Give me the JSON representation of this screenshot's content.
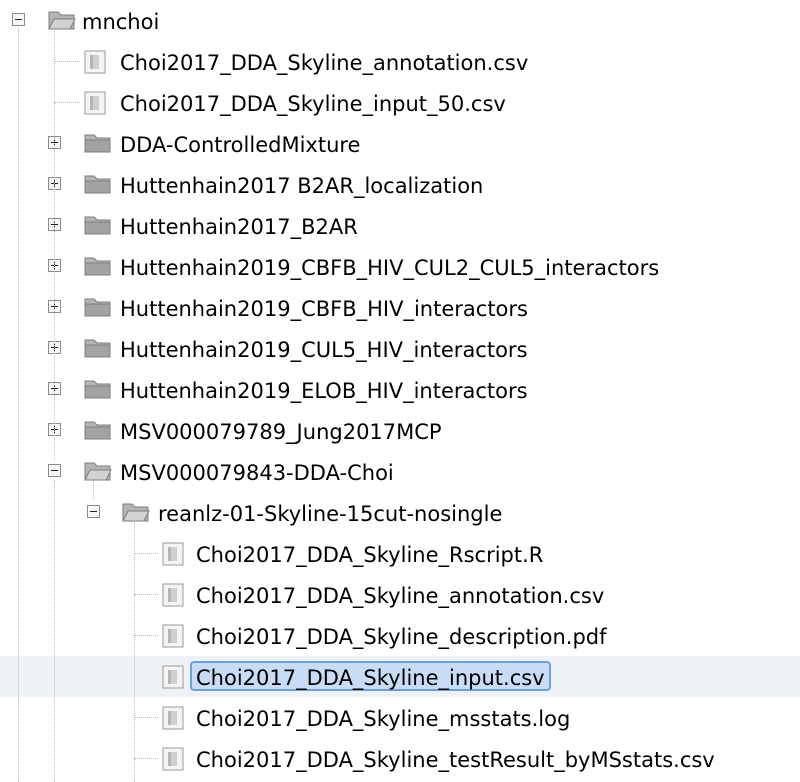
{
  "tree": {
    "root": {
      "label": "mnchoi",
      "expanded": true
    },
    "children": [
      {
        "label": "Choi2017_DDA_Skyline_annotation.csv",
        "type": "file"
      },
      {
        "label": "Choi2017_DDA_Skyline_input_50.csv",
        "type": "file"
      },
      {
        "label": "DDA-ControlledMixture",
        "type": "folder",
        "expanded": false
      },
      {
        "label": "Huttenhain2017 B2AR_localization",
        "type": "folder",
        "expanded": false
      },
      {
        "label": "Huttenhain2017_B2AR",
        "type": "folder",
        "expanded": false
      },
      {
        "label": "Huttenhain2019_CBFB_HIV_CUL2_CUL5_interactors",
        "type": "folder",
        "expanded": false
      },
      {
        "label": "Huttenhain2019_CBFB_HIV_interactors",
        "type": "folder",
        "expanded": false
      },
      {
        "label": "Huttenhain2019_CUL5_HIV_interactors",
        "type": "folder",
        "expanded": false
      },
      {
        "label": "Huttenhain2019_ELOB_HIV_interactors",
        "type": "folder",
        "expanded": false
      },
      {
        "label": "MSV000079789_Jung2017MCP",
        "type": "folder",
        "expanded": false
      },
      {
        "label": "MSV000079843-DDA-Choi",
        "type": "folder",
        "expanded": true
      }
    ],
    "subfolder": {
      "label": "reanlz-01-Skyline-15cut-nosingle",
      "expanded": true
    },
    "files": [
      {
        "label": "Choi2017_DDA_Skyline_Rscript.R"
      },
      {
        "label": "Choi2017_DDA_Skyline_annotation.csv"
      },
      {
        "label": "Choi2017_DDA_Skyline_description.pdf"
      },
      {
        "label": "Choi2017_DDA_Skyline_input.csv",
        "selected": true
      },
      {
        "label": "Choi2017_DDA_Skyline_mss tats.log"
      },
      {
        "label": "Choi2017_DDA_Skyline_testResult_byMSstats.csv"
      }
    ]
  },
  "colors": {
    "selection_fill": "#c9dcf5",
    "selection_border": "#6aa0e0",
    "row_highlight": "#eef1f5",
    "folder": "#a8a8a8",
    "file": "#9e9e9e"
  },
  "icons": {
    "folder_closed": "folder-icon",
    "folder_open": "folder-open-icon",
    "file": "file-icon",
    "expand": "expand-toggle",
    "collapse": "collapse-toggle"
  }
}
